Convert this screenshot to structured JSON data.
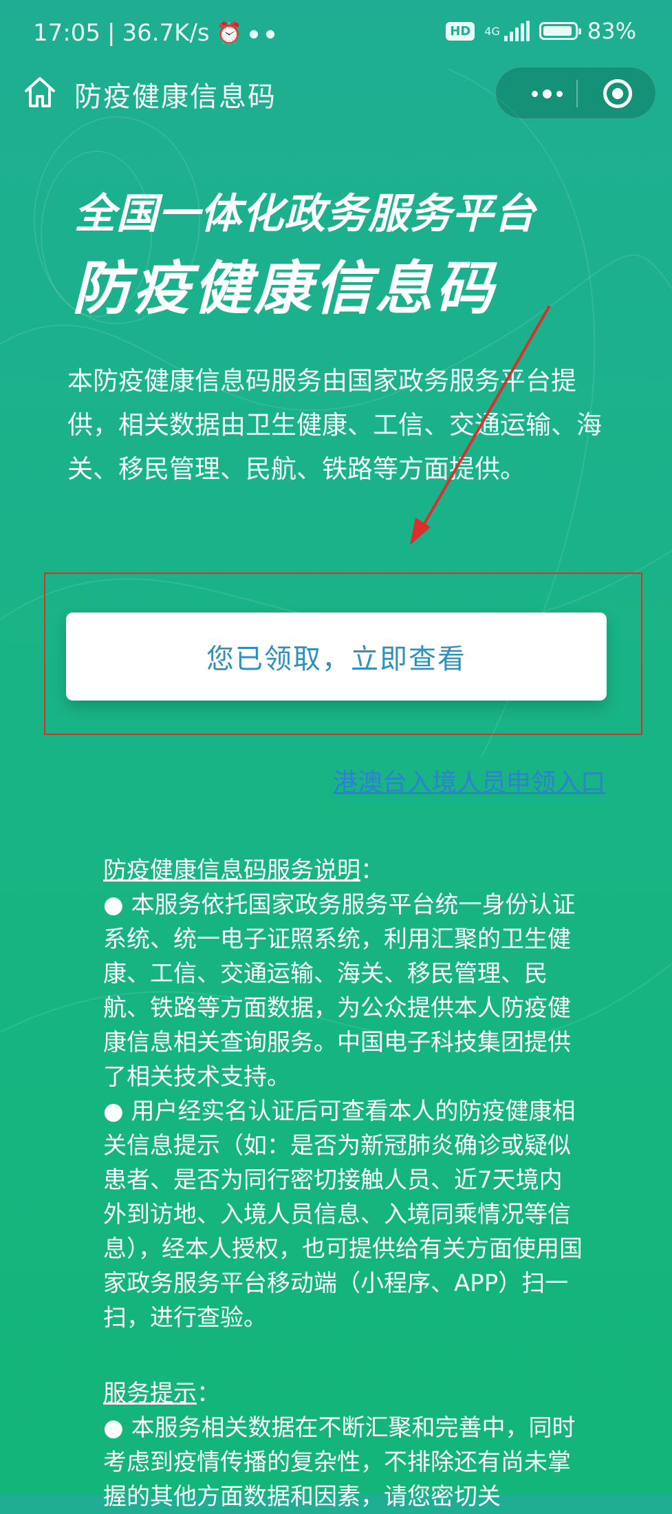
{
  "status_bar": {
    "time": "17:05",
    "net_speed": "36.7K/s",
    "hd": "HD",
    "network": "4G",
    "battery": "83%"
  },
  "nav": {
    "title": "防疫健康信息码"
  },
  "hero": {
    "subtitle": "全国一体化政务服务平台",
    "title": "防疫健康信息码",
    "intro": "本防疫健康信息码服务由国家政务服务平台提供，相关数据由卫生健康、工信、交通运输、海关、移民管理、民航、铁路等方面提供。"
  },
  "primary_button": "您已领取，立即查看",
  "hk_link": "港澳台入境人员申领入口",
  "service_desc": {
    "heading": "防疫健康信息码服务说明",
    "colon": "：",
    "p1": "本服务依托国家政务服务平台统一身份认证系统、统一电子证照系统，利用汇聚的卫生健康、工信、交通运输、海关、移民管理、民航、铁路等方面数据，为公众提供本人防疫健康信息相关查询服务。中国电子科技集团提供了相关技术支持。",
    "p2": "用户经实名认证后可查看本人的防疫健康相关信息提示（如：是否为新冠肺炎确诊或疑似患者、是否为同行密切接触人员、近7天境内外到访地、入境人员信息、入境同乘情况等信息），经本人授权，也可提供给有关方面使用国家政务服务平台移动端（小程序、APP）扫一扫，进行查验。"
  },
  "service_tips": {
    "heading": "服务提示",
    "colon": "：",
    "p1": "本服务相关数据在不断汇聚和完善中，同时考虑到疫情传播的复杂性，不排除还有尚未掌握的其他方面数据和因素，请您密切关"
  },
  "colors": {
    "bg_top": "#1fae93",
    "bg_bottom": "#13b579",
    "button_text": "#2e8fc0",
    "link": "#2f7fd6",
    "annotation": "#d8302a"
  }
}
